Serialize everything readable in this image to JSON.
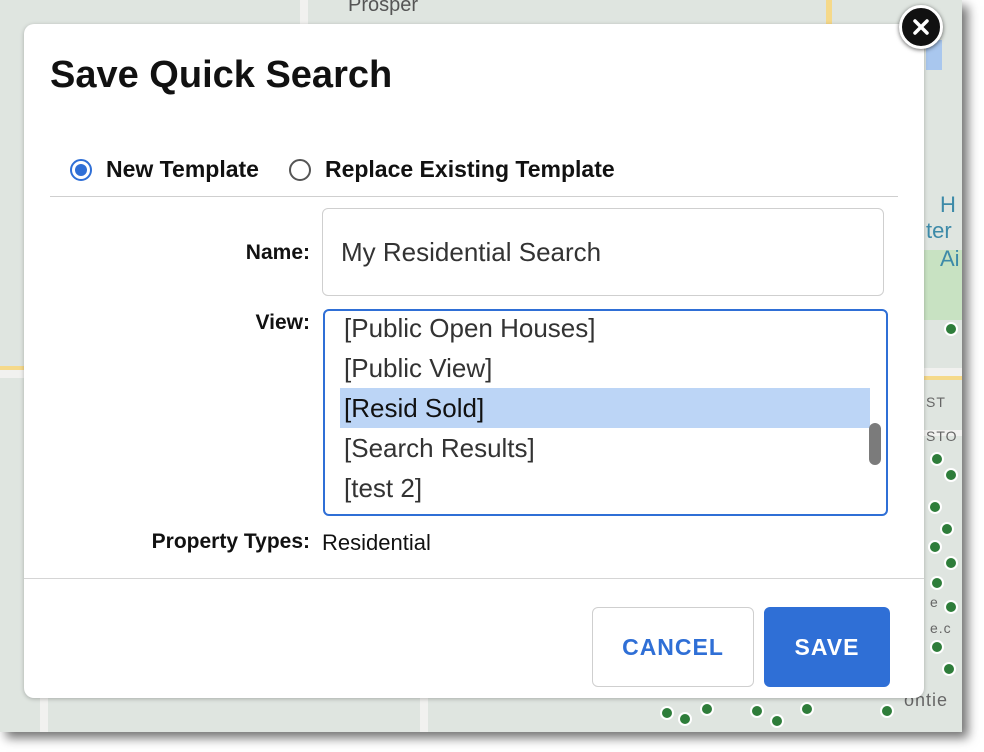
{
  "dialog": {
    "title": "Save Quick Search",
    "close_icon": "close-icon"
  },
  "template_mode": {
    "options": [
      {
        "label": "New Template",
        "checked": true
      },
      {
        "label": "Replace Existing Template",
        "checked": false
      }
    ]
  },
  "form": {
    "name_label": "Name:",
    "name_value": "My Residential Search",
    "view_label": "View:",
    "view_options": [
      {
        "label": "[Public Open Houses]",
        "selected": false
      },
      {
        "label": "[Public View]",
        "selected": false
      },
      {
        "label": "[Resid Sold]",
        "selected": true
      },
      {
        "label": "[Search Results]",
        "selected": false
      },
      {
        "label": "[test 2]",
        "selected": false
      }
    ],
    "property_types_label": "Property Types:",
    "property_types_value": "Residential"
  },
  "actions": {
    "cancel_label": "CANCEL",
    "save_label": "SAVE"
  },
  "map": {
    "labels": [
      "Prosper",
      "H",
      "ter",
      "Ai",
      "ST",
      "STO",
      "e",
      "e.c",
      "ontie"
    ]
  },
  "colors": {
    "accent": "#2f6fd6",
    "selection": "#bcd5f6",
    "marker": "#2e7d3a"
  }
}
